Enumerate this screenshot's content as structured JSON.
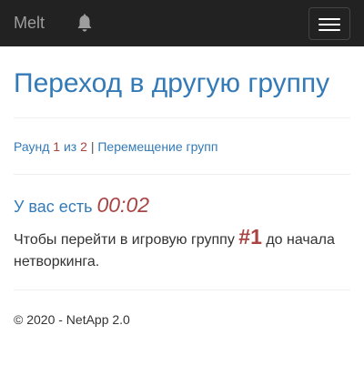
{
  "navbar": {
    "brand": "Melt",
    "bell_icon": "bell-icon",
    "menu_icon": "hamburger-menu-icon",
    "background": "#222222"
  },
  "page": {
    "title": "Переход в другую группу"
  },
  "round": {
    "prefix": "Раунд",
    "current": "1",
    "of_label": "из",
    "total": "2",
    "separator": "|",
    "link_label": "Перемещение групп"
  },
  "timer": {
    "label": "У вас есть",
    "value": "00:02"
  },
  "info": {
    "before": "Чтобы перейти в игровую группу",
    "group": "#1",
    "after": "до начала нетворкинга."
  },
  "footer": {
    "text": "© 2020 - NetApp 2.0"
  },
  "colors": {
    "accent": "#337ab7",
    "highlight": "#a94442",
    "text": "#333333"
  }
}
